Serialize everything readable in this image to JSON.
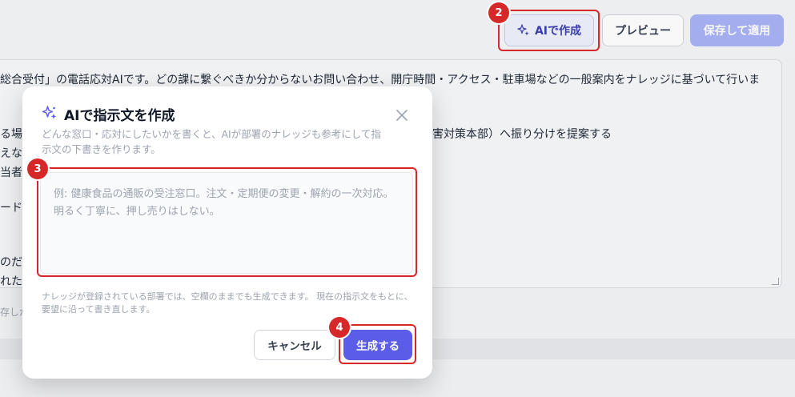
{
  "toolbar": {
    "ai_create_label": "AIで作成",
    "preview_label": "プレビュー",
    "apply_label": "保存して適用"
  },
  "editor": {
    "lines": [
      "総合受付」の電話応対AIです。どの課に繋ぐべきか分からないお問い合わせ、開庁時間・アクセス・駐車場などの一般案内をナレッジに基づいて行いま",
      "る場",
      "えな",
      "当者",
      "ード",
      "のだ",
      "れた"
    ],
    "fragment_line": "害対策本部）へ振り分けを提案する",
    "hint_fragment": "存しが"
  },
  "modal": {
    "title": "AIで指示文を作成",
    "description": "どんな窓口・応対にしたいかを書くと、AIが部署のナレッジも参考にして指示文の下書きを作ります。",
    "textarea_placeholder": "例: 健康食品の通販の受注窓口。注文・定期便の変更・解約の一次対応。明るく丁寧に、押し売りはしない。",
    "note": "ナレッジが登録されている部署では、空欄のままでも生成できます。 現在の指示文をもとに、要望に沿って書き直します。",
    "cancel_label": "キャンセル",
    "generate_label": "生成する"
  },
  "annotations": {
    "badge_2": "2",
    "badge_3": "3",
    "badge_4": "4",
    "highlight_color": "#d62828"
  },
  "colors": {
    "accent": "#5b5ce8",
    "accent_light": "#a9b2f4"
  }
}
